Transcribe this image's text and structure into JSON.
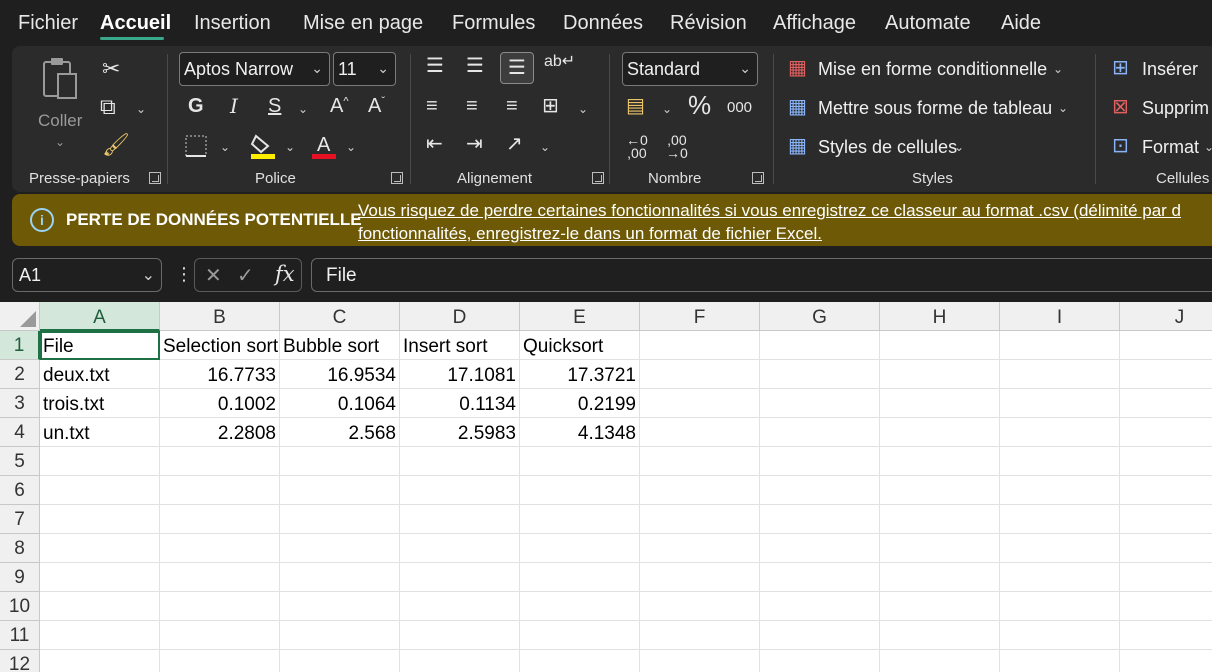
{
  "menu": {
    "items": [
      "Fichier",
      "Accueil",
      "Insertion",
      "Mise en page",
      "Formules",
      "Données",
      "Révision",
      "Affichage",
      "Automate",
      "Aide"
    ],
    "active": "Accueil"
  },
  "ribbon": {
    "clipboard": {
      "paste_label": "Coller",
      "group_label": "Presse-papiers"
    },
    "font": {
      "font_name": "Aptos Narrow",
      "font_size": "11",
      "bold_label": "G",
      "italic_label": "I",
      "underline_label": "S",
      "group_label": "Police",
      "highlight_color": "#ffee00",
      "font_color": "#e81123"
    },
    "alignment": {
      "group_label": "Alignement"
    },
    "number": {
      "format": "Standard",
      "percent_label": "%",
      "thousands_label": "000",
      "group_label": "Nombre"
    },
    "styles": {
      "conditional_label": "Mise en forme conditionnelle",
      "table_label": "Mettre sous forme de tableau",
      "cell_styles_label": "Styles de cellules",
      "group_label": "Styles"
    },
    "cells": {
      "insert_label": "Insérer",
      "delete_label": "Supprim",
      "format_label": "Format",
      "group_label": "Cellules"
    }
  },
  "warning": {
    "title": "PERTE DE DONNÉES POTENTIELLE",
    "message": "Vous risquez de perdre certaines fonctionnalités si vous enregistrez ce classeur au format .csv (délimité par d fonctionnalités, enregistrez-le dans un format de fichier Excel."
  },
  "formula_bar": {
    "name_box": "A1",
    "formula": "File"
  },
  "sheet": {
    "columns": [
      "A",
      "B",
      "C",
      "D",
      "E",
      "F",
      "G",
      "H",
      "I",
      "J"
    ],
    "rows": [
      "1",
      "2",
      "3",
      "4",
      "5",
      "6",
      "7",
      "8",
      "9",
      "10",
      "11",
      "12"
    ],
    "data": [
      [
        "File",
        "Selection sort",
        "Bubble sort",
        "Insert sort",
        "Quicksort"
      ],
      [
        "deux.txt",
        "16.7733",
        "16.9534",
        "17.1081",
        "17.3721"
      ],
      [
        "trois.txt",
        "0.1002",
        "0.1064",
        "0.1134",
        "0.2199"
      ],
      [
        "un.txt",
        "2.2808",
        "2.568",
        "2.5983",
        "4.1348"
      ]
    ]
  }
}
